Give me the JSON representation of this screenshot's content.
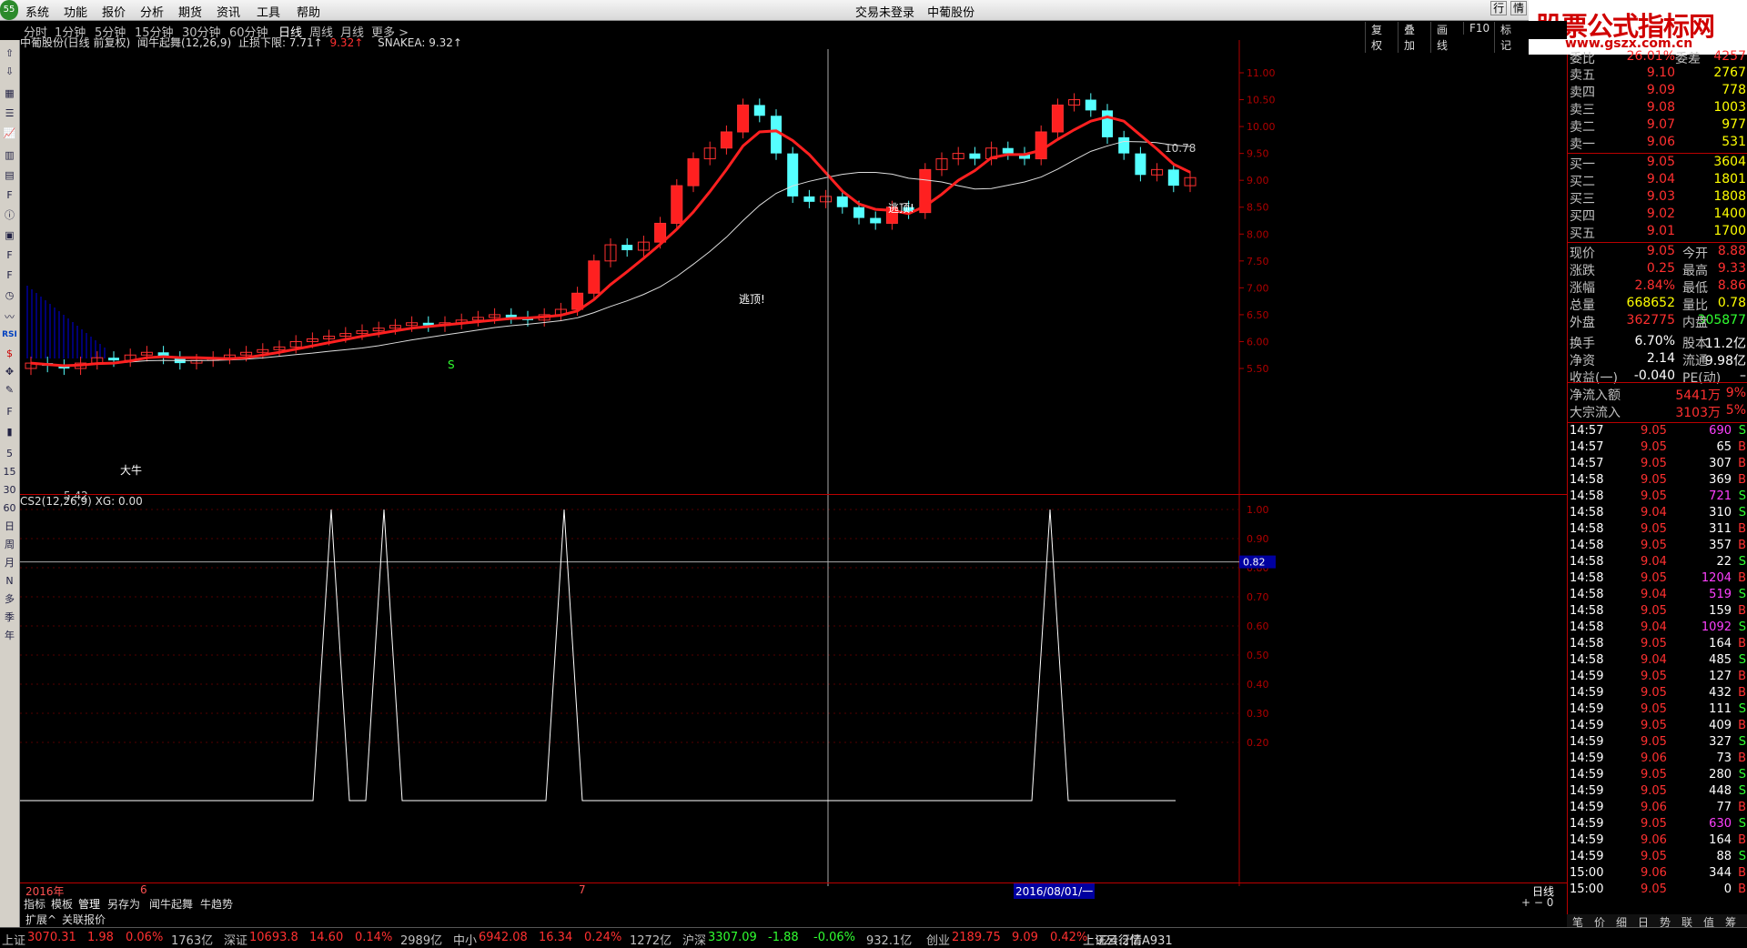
{
  "menu": [
    "系统",
    "功能",
    "报价",
    "分析",
    "期货",
    "资讯",
    "工具",
    "帮助"
  ],
  "title": {
    "login": "交易未登录",
    "stock": "中葡股份"
  },
  "brand": {
    "name": "股票公式指标网",
    "url": "www.gszx.com.cn",
    "tabs": [
      "行",
      "情"
    ]
  },
  "periods": [
    "分时",
    "1分钟",
    "5分钟",
    "15分钟",
    "30分钟",
    "60分钟",
    "日线",
    "周线",
    "月线",
    "更多 >"
  ],
  "active_period": "日线",
  "toolbar": [
    "复权",
    "叠加",
    "画线",
    "F10",
    "标记"
  ],
  "left_tools": [
    "RSI",
    "5",
    "15",
    "30",
    "60",
    "日",
    "周",
    "月",
    "N",
    "多",
    "季",
    "年"
  ],
  "main_header": {
    "stock": "中葡股份(日线 前复权)",
    "indicator": "闻牛起舞(12,26,9)",
    "stop_label": "止损下限: 7.71↑",
    "stop_val2": "9.32↑",
    "snake": "SNAKEA: 9.32↑"
  },
  "annotations": {
    "escape1": "逃顶!",
    "escape2": "逃顶!",
    "big_bull": "大牛",
    "low": "5.42",
    "high": "10.78",
    "s": "S"
  },
  "price_axis": [
    "11.00",
    "10.50",
    "10.00",
    "9.50",
    "9.00",
    "8.50",
    "8.00",
    "7.50",
    "7.00",
    "6.50",
    "6.00",
    "5.50"
  ],
  "sub_header": "CS2(12,26,9)  XG: 0.00",
  "sub_axis": [
    "1.00",
    "0.90",
    "0.80",
    "0.70",
    "0.60",
    "0.50",
    "0.40",
    "0.30",
    "0.20"
  ],
  "sub_cursor": "0.82",
  "dates": {
    "d1": "2016年",
    "d2": "6",
    "d3": "7",
    "d4": "2016/08/01/一",
    "period": "日线"
  },
  "bottom_tabs": [
    "指标",
    "模板",
    "管理",
    "另存为",
    "闻牛起舞",
    "牛趋势"
  ],
  "bottom_tabs2": [
    "扩展^",
    "关联报价"
  ],
  "order_book": {
    "ratio_label": "委比",
    "ratio": "26.01%",
    "diff_label": "委差",
    "diff": "4257",
    "sells": [
      {
        "label": "卖五",
        "price": "9.10",
        "vol": "2767"
      },
      {
        "label": "卖四",
        "price": "9.09",
        "vol": "778"
      },
      {
        "label": "卖三",
        "price": "9.08",
        "vol": "1003"
      },
      {
        "label": "卖二",
        "price": "9.07",
        "vol": "977"
      },
      {
        "label": "卖一",
        "price": "9.06",
        "vol": "531"
      }
    ],
    "buys": [
      {
        "label": "买一",
        "price": "9.05",
        "vol": "3604"
      },
      {
        "label": "买二",
        "price": "9.04",
        "vol": "1801"
      },
      {
        "label": "买三",
        "price": "9.03",
        "vol": "1808"
      },
      {
        "label": "买四",
        "price": "9.02",
        "vol": "1400"
      },
      {
        "label": "买五",
        "price": "9.01",
        "vol": "1700"
      }
    ]
  },
  "quote": [
    {
      "l1": "现价",
      "v1": "9.05",
      "l2": "今开",
      "v2": "8.88",
      "c1": "red",
      "c2": "red"
    },
    {
      "l1": "涨跌",
      "v1": "0.25",
      "l2": "最高",
      "v2": "9.33",
      "c1": "red",
      "c2": "red"
    },
    {
      "l1": "涨幅",
      "v1": "2.84%",
      "l2": "最低",
      "v2": "8.86",
      "c1": "red",
      "c2": "red"
    },
    {
      "l1": "总量",
      "v1": "668652",
      "l2": "量比",
      "v2": "0.78",
      "c1": "yel",
      "c2": "yel"
    },
    {
      "l1": "外盘",
      "v1": "362775",
      "l2": "内盘",
      "v2": "305877",
      "c1": "red",
      "c2": "green"
    },
    {
      "l1": "换手",
      "v1": "6.70%",
      "l2": "股本",
      "v2": "11.2亿",
      "c1": "white",
      "c2": "white"
    },
    {
      "l1": "净资",
      "v1": "2.14",
      "l2": "流通",
      "v2": "9.98亿",
      "c1": "white",
      "c2": "white"
    },
    {
      "l1": "收益(一)",
      "v1": "-0.040",
      "l2": "PE(动)",
      "v2": "–",
      "c1": "white",
      "c2": "white"
    }
  ],
  "flows": [
    {
      "label": "净流入额",
      "val": "5441万",
      "pct": "9%"
    },
    {
      "label": "大宗流入",
      "val": "3103万",
      "pct": "5%"
    }
  ],
  "ticks": [
    [
      "14:57",
      "9.05",
      "690",
      "S"
    ],
    [
      "14:57",
      "9.05",
      "65",
      "B"
    ],
    [
      "14:57",
      "9.05",
      "307",
      "B"
    ],
    [
      "14:58",
      "9.05",
      "369",
      "B"
    ],
    [
      "14:58",
      "9.05",
      "721",
      "S"
    ],
    [
      "14:58",
      "9.04",
      "310",
      "S"
    ],
    [
      "14:58",
      "9.05",
      "311",
      "B"
    ],
    [
      "14:58",
      "9.05",
      "357",
      "B"
    ],
    [
      "14:58",
      "9.04",
      "22",
      "S"
    ],
    [
      "14:58",
      "9.05",
      "1204",
      "B"
    ],
    [
      "14:58",
      "9.04",
      "519",
      "S"
    ],
    [
      "14:58",
      "9.05",
      "159",
      "B"
    ],
    [
      "14:58",
      "9.04",
      "1092",
      "S"
    ],
    [
      "14:58",
      "9.05",
      "164",
      "B"
    ],
    [
      "14:58",
      "9.04",
      "485",
      "S"
    ],
    [
      "14:59",
      "9.05",
      "127",
      "B"
    ],
    [
      "14:59",
      "9.05",
      "432",
      "B"
    ],
    [
      "14:59",
      "9.05",
      "111",
      "S"
    ],
    [
      "14:59",
      "9.05",
      "409",
      "B"
    ],
    [
      "14:59",
      "9.05",
      "327",
      "S"
    ],
    [
      "14:59",
      "9.06",
      "73",
      "B"
    ],
    [
      "14:59",
      "9.05",
      "280",
      "S"
    ],
    [
      "14:59",
      "9.05",
      "448",
      "S"
    ],
    [
      "14:59",
      "9.06",
      "77",
      "B"
    ],
    [
      "14:59",
      "9.05",
      "630",
      "S"
    ],
    [
      "14:59",
      "9.06",
      "164",
      "B"
    ],
    [
      "14:59",
      "9.05",
      "88",
      "S"
    ],
    [
      "15:00",
      "9.06",
      "344",
      "B"
    ],
    [
      "15:00",
      "9.05",
      "0",
      "B"
    ]
  ],
  "right_bottom": [
    "笔",
    "价",
    "细",
    "日",
    "势",
    "联",
    "值",
    "筹"
  ],
  "status": [
    {
      "name": "上证",
      "val": "3070.31",
      "chg": "1.98",
      "pct": "0.06%",
      "amt": "1763亿"
    },
    {
      "name": "深证",
      "val": "10693.8",
      "chg": "14.60",
      "pct": "0.14%",
      "amt": "2989亿"
    },
    {
      "name": "中小",
      "val": "6942.08",
      "chg": "16.34",
      "pct": "0.24%",
      "amt": "1272亿"
    },
    {
      "name": "沪深",
      "val": "3307.09",
      "chg": "-1.88",
      "pct": "-0.06%",
      "amt": "932.1亿"
    },
    {
      "name": "创业",
      "val": "2189.75",
      "chg": "9.09",
      "pct": "0.42%",
      "amt": "924.2亿"
    }
  ],
  "status_tail": "上证云行情A931",
  "colors": {
    "up": "#ff3030",
    "down": "#30ff30",
    "cyan": "#55ffff",
    "yellow": "#ffff00",
    "sep": "#b00000"
  }
}
